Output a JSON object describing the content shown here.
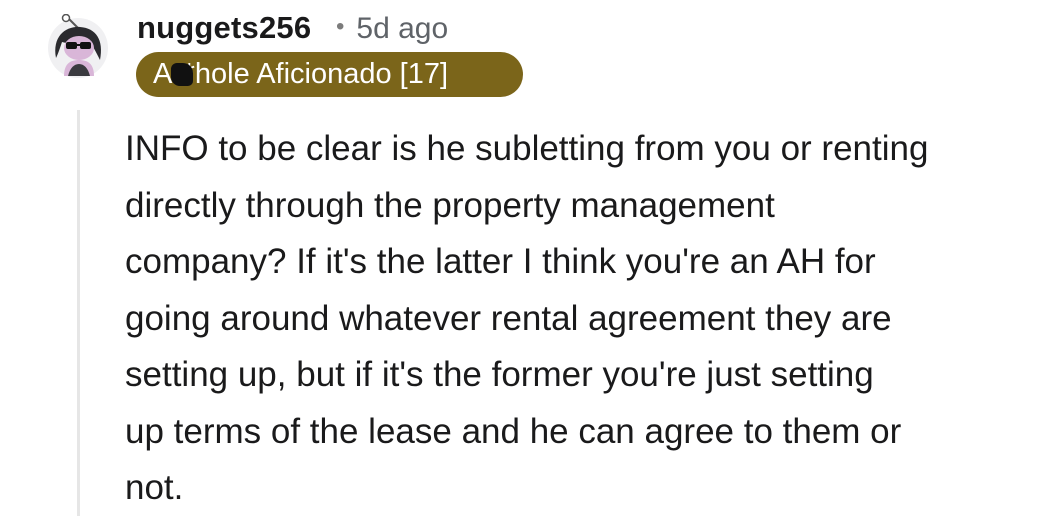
{
  "comment": {
    "author": {
      "username": "nuggets256",
      "avatar_icon": "snoo-avatar-icon",
      "flair": "A**hole Aficionado [17]",
      "flair_color": "#7b651a"
    },
    "separator": "•",
    "timestamp": "5d ago",
    "body_lines": [
      "INFO to be clear is he subletting from you or renting",
      "directly through the property management",
      "company? If it's the latter I think you're an AH for",
      "going around whatever rental agreement they are",
      "setting up, but if it's the former you're just setting",
      "up terms of the lease and he can agree to them or",
      "not."
    ]
  }
}
